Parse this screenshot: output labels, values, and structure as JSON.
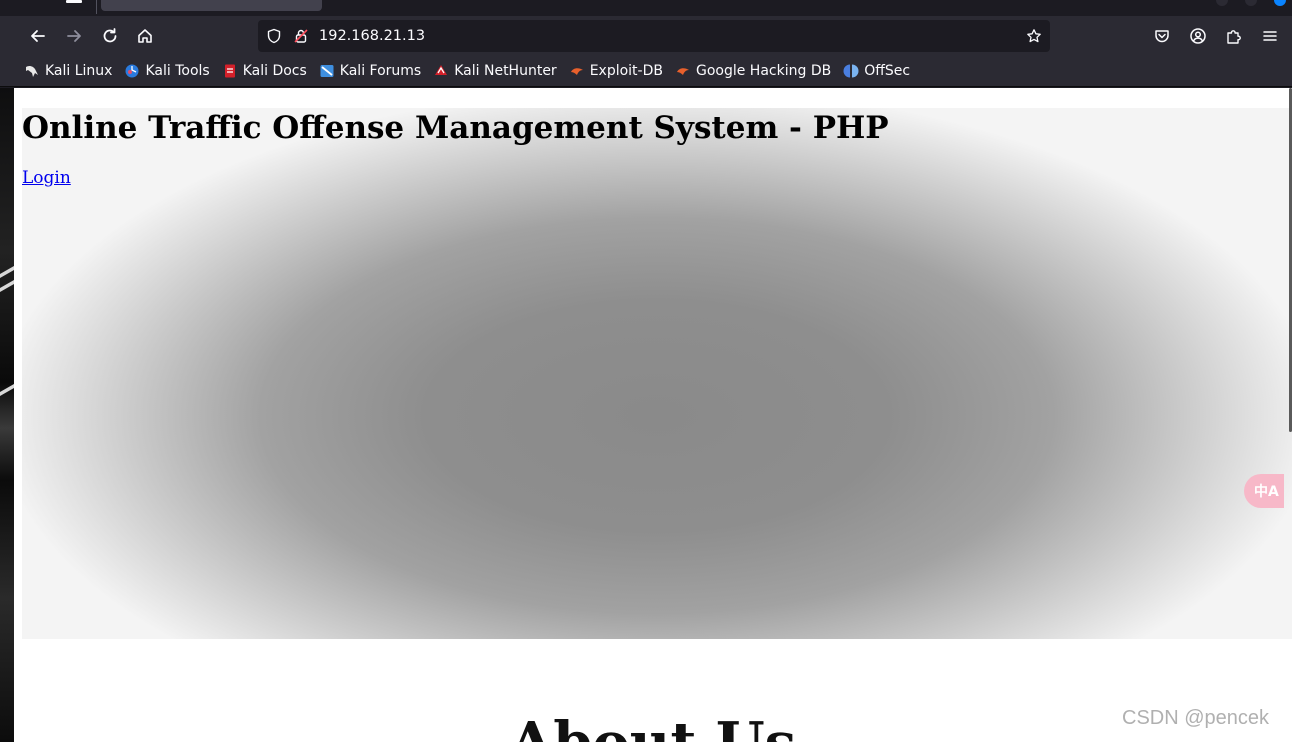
{
  "browser": {
    "url": "192.168.21.13",
    "bookmarks": [
      {
        "label": "Kali Linux",
        "icon": "kali-dragon-icon",
        "color": "#222222"
      },
      {
        "label": "Kali Tools",
        "icon": "kali-tools-icon",
        "color": "#2a7bde"
      },
      {
        "label": "Kali Docs",
        "icon": "kali-docs-icon",
        "color": "#d4202a"
      },
      {
        "label": "Kali Forums",
        "icon": "kali-forums-icon",
        "color": "#3e8fe0"
      },
      {
        "label": "Kali NetHunter",
        "icon": "kali-nethunter-icon",
        "color": "#d4202a"
      },
      {
        "label": "Exploit-DB",
        "icon": "exploit-db-icon",
        "color": "#e8602c"
      },
      {
        "label": "Google Hacking DB",
        "icon": "google-hacking-db-icon",
        "color": "#e8602c"
      },
      {
        "label": "OffSec",
        "icon": "offsec-icon",
        "color": "#4a7fe0"
      }
    ]
  },
  "page": {
    "site_title": "Online Traffic Offense Management System - PHP",
    "login_link": "Login",
    "about_heading": "About Us",
    "translate_button": "中A"
  },
  "watermark": "CSDN @pencek"
}
